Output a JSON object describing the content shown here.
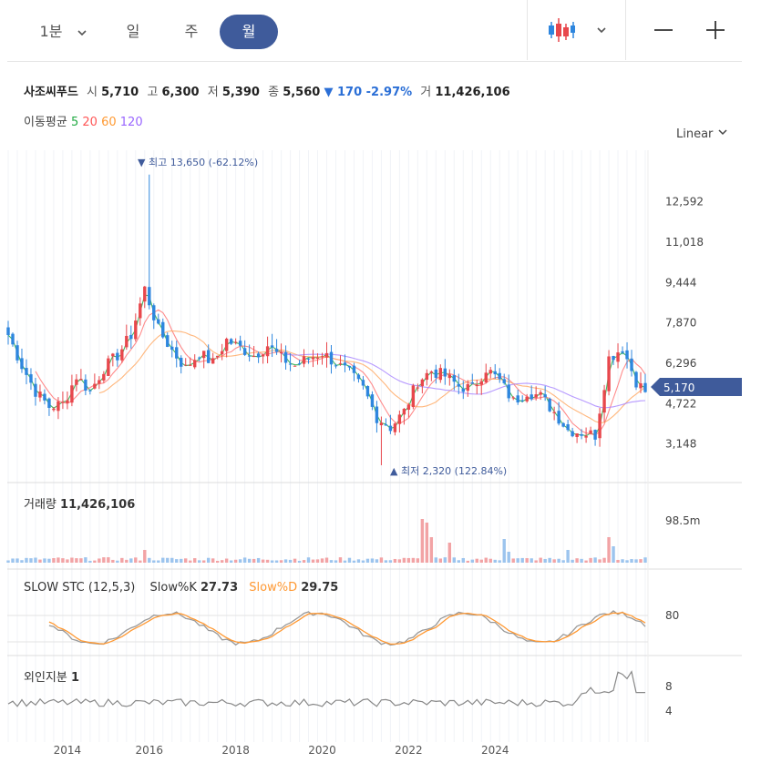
{
  "toolbar": {
    "tabs": [
      {
        "label": "1분",
        "active": false
      },
      {
        "label": "일",
        "active": false
      },
      {
        "label": "주",
        "active": false
      },
      {
        "label": "월",
        "active": true
      }
    ],
    "chart_type_icon": "candlestick-icon",
    "zoom_out_icon": "minus-icon",
    "zoom_in_icon": "plus-icon"
  },
  "info": {
    "name": "사조씨푸드",
    "open_label": "시",
    "open": "5,710",
    "high_label": "고",
    "high": "6,300",
    "low_label": "저",
    "low": "5,390",
    "close_label": "종",
    "close": "5,560",
    "change": "▼ 170 -2.97%",
    "volume_label": "거",
    "volume": "11,426,106"
  },
  "ma": {
    "label": "이동평균",
    "p5": "5",
    "p20": "20",
    "p60": "60",
    "p120": "120",
    "colors": {
      "p5": "#22aa44",
      "p20": "#ff5555",
      "p60": "#ff9a33",
      "p120": "#9966ff"
    }
  },
  "scale_mode": "Linear",
  "colors": {
    "up": "#e8474c",
    "down": "#2e86de",
    "accent": "#3f5b9b"
  },
  "chart_data": [
    {
      "type": "candlestick",
      "x_ticks": [
        "2014",
        "2016",
        "2018",
        "2020",
        "2022",
        "2024"
      ],
      "y_ticks": [
        "12,592",
        "11,018",
        "9,444",
        "7,870",
        "6,296",
        "4,722",
        "3,148"
      ],
      "ylim": [
        2000,
        14600
      ],
      "current_price": "5,170",
      "high_annotation": "▼ 최고 13,650 (-62.12%)",
      "low_annotation": "▲ 최저 2,320 (122.84%)",
      "close_anchors": [
        [
          0,
          7400
        ],
        [
          3,
          6200
        ],
        [
          6,
          5200
        ],
        [
          9,
          4600
        ],
        [
          12,
          4700
        ],
        [
          15,
          5800
        ],
        [
          18,
          5200
        ],
        [
          21,
          6100
        ],
        [
          24,
          6600
        ],
        [
          27,
          7400
        ],
        [
          30,
          9200
        ],
        [
          33,
          7600
        ],
        [
          36,
          6800
        ],
        [
          39,
          6100
        ],
        [
          42,
          6700
        ],
        [
          45,
          6300
        ],
        [
          48,
          7200
        ],
        [
          51,
          6900
        ],
        [
          54,
          6600
        ],
        [
          57,
          7000
        ],
        [
          60,
          6500
        ],
        [
          63,
          6200
        ],
        [
          66,
          6500
        ],
        [
          69,
          6700
        ],
        [
          72,
          6300
        ],
        [
          75,
          5900
        ],
        [
          78,
          5300
        ],
        [
          81,
          4200
        ],
        [
          84,
          3800
        ],
        [
          87,
          4400
        ],
        [
          90,
          5600
        ],
        [
          93,
          6000
        ],
        [
          96,
          5800
        ],
        [
          99,
          5400
        ],
        [
          102,
          5300
        ],
        [
          105,
          6100
        ],
        [
          108,
          5600
        ],
        [
          111,
          4800
        ],
        [
          114,
          5200
        ],
        [
          117,
          5000
        ],
        [
          120,
          4400
        ],
        [
          123,
          3700
        ],
        [
          126,
          3600
        ],
        [
          129,
          3500
        ],
        [
          132,
          6500
        ],
        [
          135,
          6900
        ],
        [
          138,
          5600
        ],
        [
          140,
          5170
        ]
      ],
      "volume": {
        "label": "거래량",
        "value": "11,426,106",
        "tick": "98.5m"
      },
      "stochastic": {
        "label": "SLOW STC (12,5,3)",
        "k_label": "Slow%K",
        "k": "27.73",
        "d_label": "Slow%D",
        "d": "29.75",
        "tick": "80",
        "k_color": "#999999",
        "d_color": "#ff9933"
      },
      "foreign": {
        "label": "외인지분",
        "value": "1",
        "ticks": [
          "8",
          "4"
        ]
      }
    }
  ]
}
